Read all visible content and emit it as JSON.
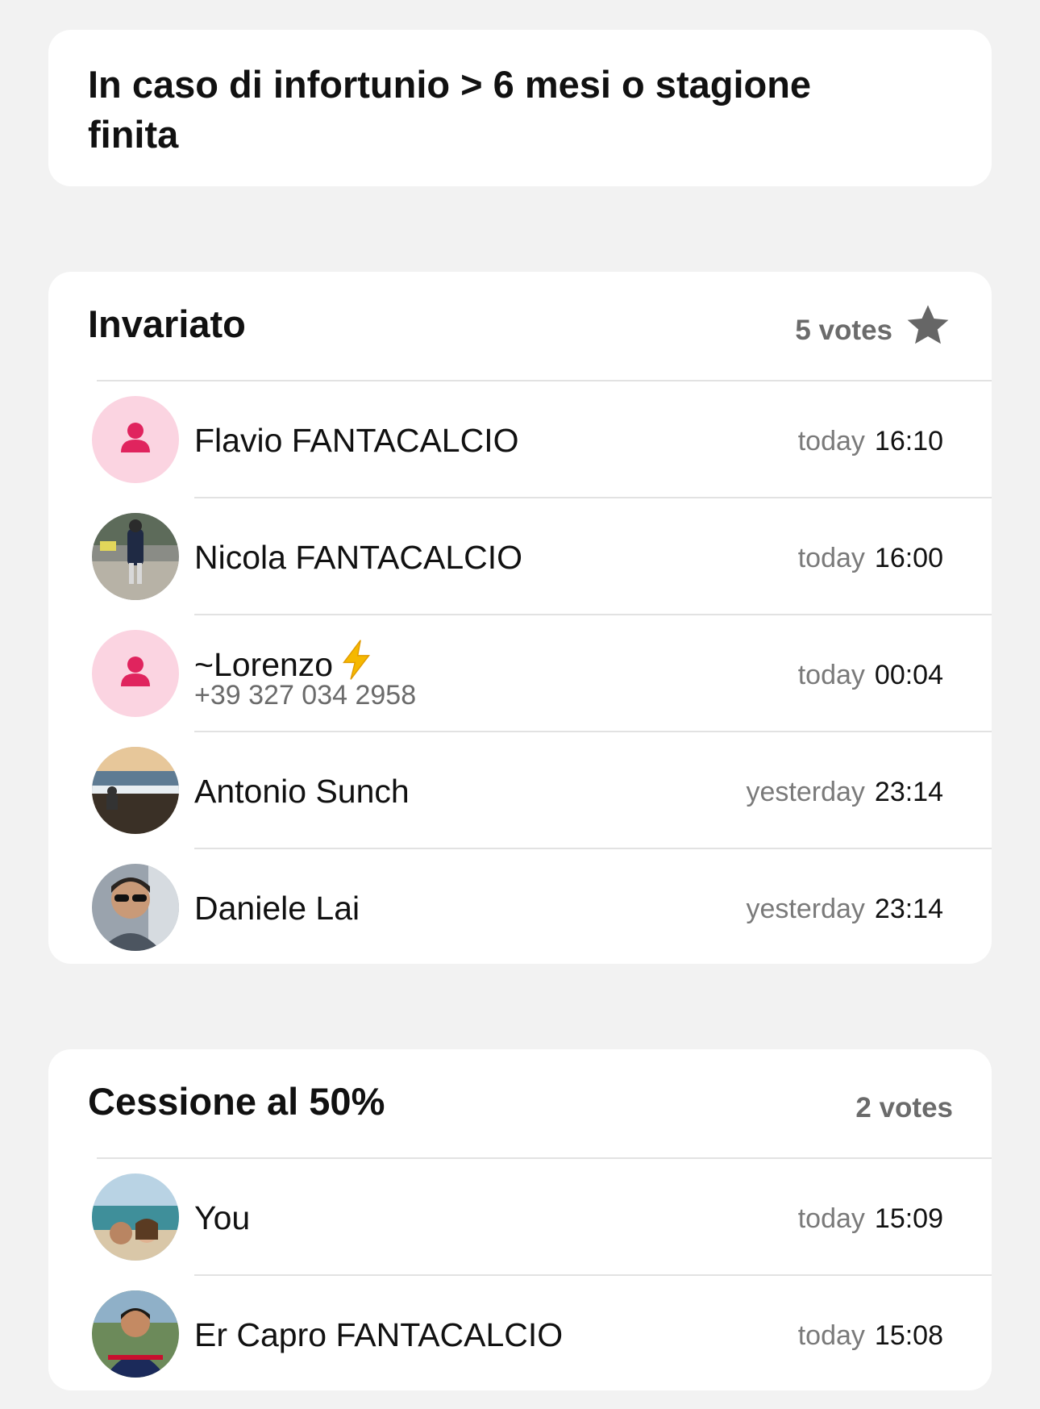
{
  "question": {
    "title": "In caso di infortunio > 6 mesi o stagione finita"
  },
  "options": [
    {
      "title": "Invariato",
      "votes_label": "5 votes",
      "starred": true,
      "voters": [
        {
          "name": "Flavio FANTACALCIO",
          "day": "today",
          "time": "16:10",
          "avatar": "default-avatar-icon"
        },
        {
          "name": "Nicola FANTACALCIO",
          "day": "today",
          "time": "16:00",
          "avatar": "photo"
        },
        {
          "name": "~Lorenzo",
          "emoji": "high-voltage-icon",
          "phone": "+39 327 034 2958",
          "day": "today",
          "time": "00:04",
          "avatar": "default-avatar-icon"
        },
        {
          "name": "Antonio Sunch",
          "day": "yesterday",
          "time": "23:14",
          "avatar": "photo"
        },
        {
          "name": "Daniele Lai",
          "day": "yesterday",
          "time": "23:14",
          "avatar": "photo"
        }
      ]
    },
    {
      "title": "Cessione al 50%",
      "votes_label": "2 votes",
      "starred": false,
      "voters": [
        {
          "name": "You",
          "day": "today",
          "time": "15:09",
          "avatar": "photo"
        },
        {
          "name": "Er Capro FANTACALCIO",
          "day": "today",
          "time": "15:08",
          "avatar": "photo"
        }
      ]
    }
  ],
  "colors": {
    "background": "#f2f2f2",
    "card": "#ffffff",
    "secondary_text": "#6b6b6b",
    "placeholder_avatar_bg": "#fbd4e1",
    "placeholder_avatar_fg": "#e0245e",
    "star": "#666666",
    "bolt": "#f5b800"
  }
}
